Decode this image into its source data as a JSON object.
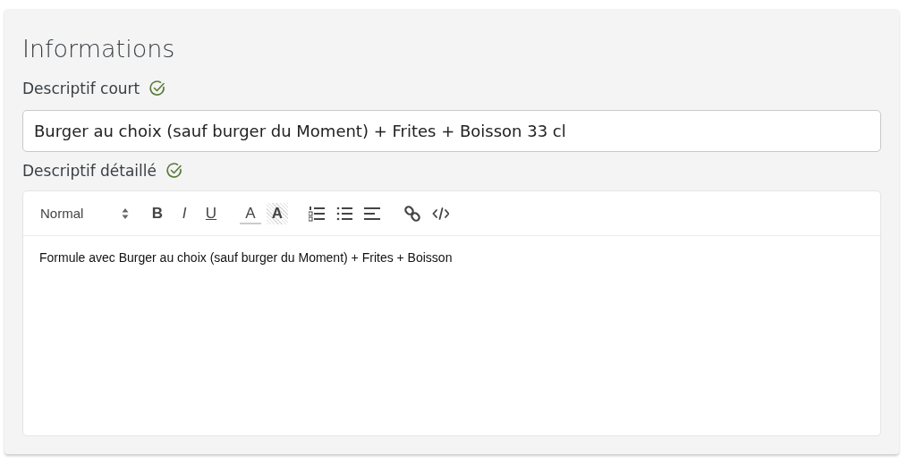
{
  "title": "Informations",
  "short_description": {
    "label": "Descriptif court",
    "valid": true,
    "value": "Burger au choix (sauf burger du Moment) + Frites + Boisson 33 cl"
  },
  "detailed_description": {
    "label": "Descriptif détaillé",
    "valid": true,
    "toolbar": {
      "format": "Normal",
      "groups": [
        [
          {
            "kind": "bold",
            "label": "B"
          },
          {
            "kind": "italic",
            "label": "I"
          },
          {
            "kind": "underline",
            "label": "U"
          }
        ],
        [
          {
            "kind": "color",
            "label": "A"
          },
          {
            "kind": "background",
            "label": "A"
          }
        ],
        [
          {
            "kind": "ordered-list"
          },
          {
            "kind": "bullet-list"
          },
          {
            "kind": "align"
          }
        ],
        [
          {
            "kind": "link"
          },
          {
            "kind": "code"
          }
        ]
      ]
    },
    "content": "Formule avec Burger au choix (sauf burger du Moment) + Frites + Boisson"
  }
}
